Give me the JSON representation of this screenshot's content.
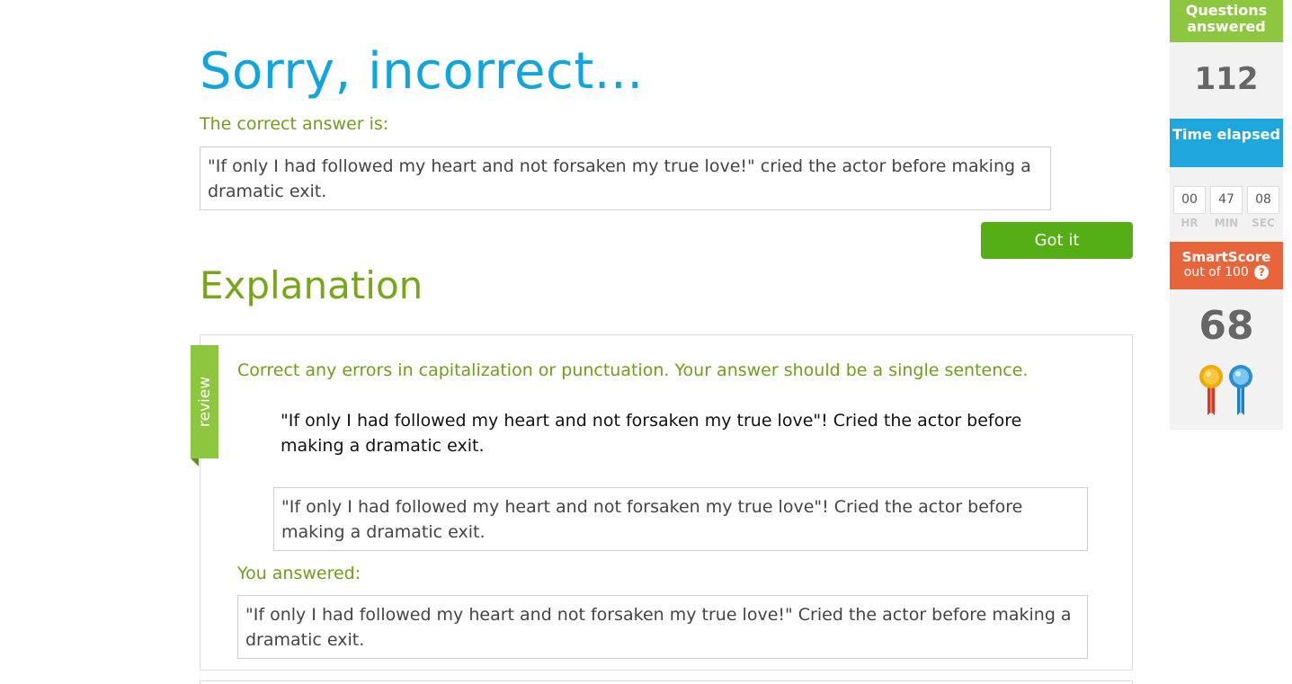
{
  "feedback": {
    "title": "Sorry, incorrect...",
    "correct_label": "The correct answer is:",
    "correct_answer": "\"If only I had followed my heart and not forsaken my true love!\" cried the actor before making a dramatic exit.",
    "got_it_label": "Got it"
  },
  "explanation": {
    "title": "Explanation",
    "ribbon_label": "review",
    "instructions": "Correct any errors in capitalization or punctuation. Your answer should be a single sentence.",
    "question_sentence": "\"If only I had followed my heart and not forsaken my true love\"! Cried the actor before making a dramatic exit.",
    "question_box_value": "\"If only I had followed my heart and not forsaken my true love\"! Cried the actor before making a dramatic exit.",
    "you_answered_label": "You answered:",
    "user_answer": "\"If only I had followed my heart and not forsaken my true love!\" Cried the actor before making a dramatic exit."
  },
  "sidebar": {
    "questions_answered_label": "Questions answered",
    "questions_answered_value": "112",
    "time_elapsed_label": "Time elapsed",
    "timer": {
      "hr": "00",
      "min": "47",
      "sec": "08",
      "hr_label": "HR",
      "min_label": "MIN",
      "sec_label": "SEC"
    },
    "smartscore_label": "SmartScore",
    "smartscore_sub": "out of 100",
    "help_icon": "?",
    "smartscore_value": "68",
    "award_icons": [
      "red-ribbon-icon",
      "blue-ribbon-icon"
    ]
  },
  "colors": {
    "title_blue": "#10a5dc",
    "green_text": "#6e9e1a",
    "explanation_green": "#78a619",
    "button_green": "#55ae15",
    "qa_green": "#8dc63f",
    "time_blue": "#1ea7dd",
    "smartscore_orange": "#e8643b"
  }
}
